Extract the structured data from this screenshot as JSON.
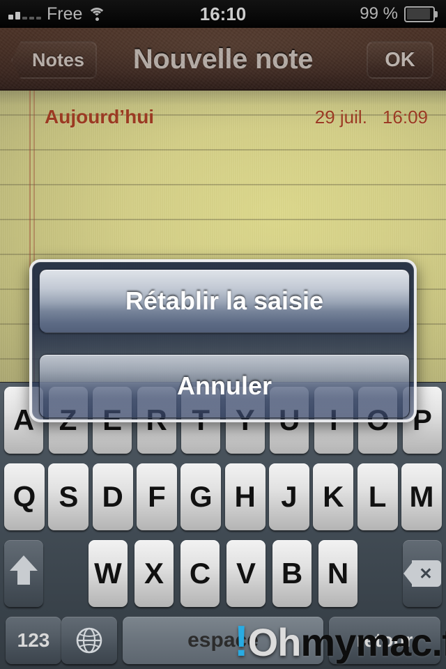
{
  "status_bar": {
    "carrier": "Free",
    "time": "16:10",
    "battery_percent": "99 %",
    "signal_icon": "signal-bars-icon",
    "wifi_icon": "wifi-icon",
    "battery_icon": "battery-icon"
  },
  "nav_bar": {
    "back_label": "Notes",
    "title": "Nouvelle note",
    "action_label": "OK"
  },
  "note": {
    "day_label": "Aujourd’hui",
    "date": "29 juil.",
    "time": "16:09",
    "body": ""
  },
  "alert": {
    "buttons": [
      {
        "label": "Rétablir la saisie"
      },
      {
        "label": "Annuler"
      }
    ]
  },
  "keyboard": {
    "layout": "AZERTY",
    "row1": [
      "A",
      "Z",
      "E",
      "R",
      "T",
      "Y",
      "U",
      "I",
      "O",
      "P"
    ],
    "row2": [
      "Q",
      "S",
      "D",
      "F",
      "G",
      "H",
      "J",
      "K",
      "L",
      "M"
    ],
    "row3": [
      "W",
      "X",
      "C",
      "V",
      "B",
      "N"
    ],
    "shift_icon": "shift-arrow-icon",
    "backspace_icon": "backspace-delete-icon",
    "numeric_label": "123",
    "globe_icon": "globe-language-icon",
    "space_label": "espace",
    "return_label": "retour"
  },
  "watermark": {
    "exclamation": "!",
    "part1": "Oh",
    "part2": "mymac.fr",
    "accent_color": "#29ABE2",
    "part1_color": "#dcdcdc",
    "part2_color": "#0d0d0d"
  }
}
